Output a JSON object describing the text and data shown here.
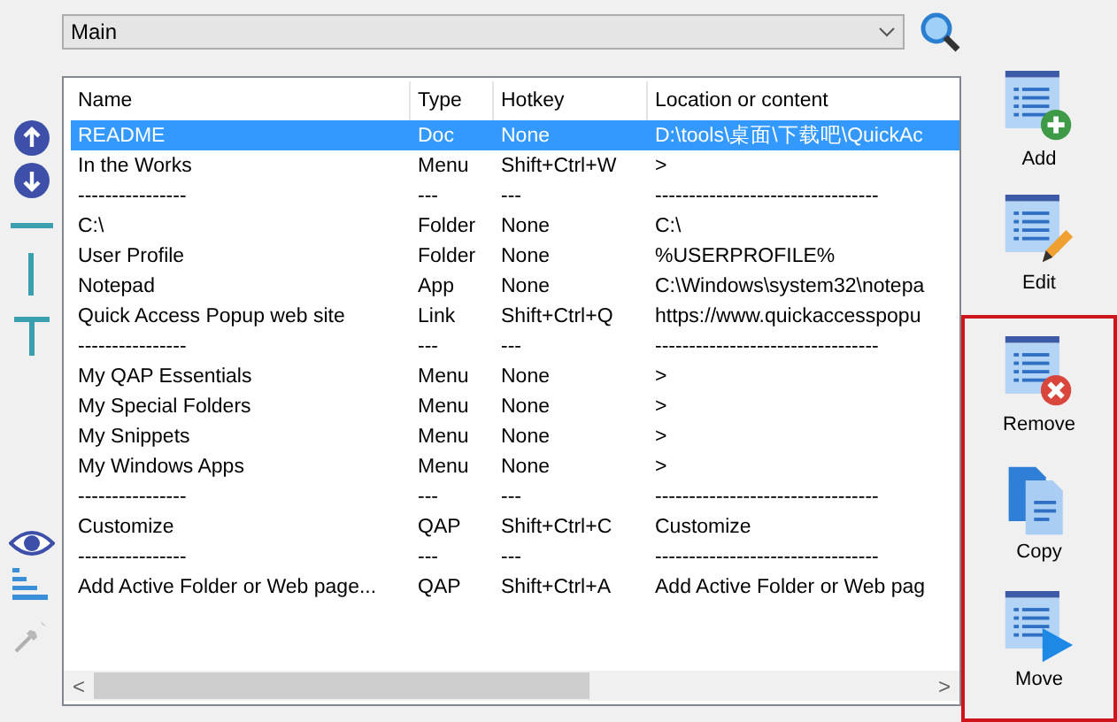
{
  "menu_dropdown": {
    "value": "Main"
  },
  "table": {
    "columns": [
      "Name",
      "Type",
      "Hotkey",
      "Location or content"
    ],
    "rows": [
      {
        "cells": [
          "README",
          "Doc",
          "None",
          "D:\\tools\\桌面\\下载吧\\QuickAc"
        ],
        "selected": true
      },
      {
        "cells": [
          "In the Works",
          "Menu",
          "Shift+Ctrl+W",
          ">"
        ],
        "selected": false
      },
      {
        "cells": [
          "----------------",
          "---",
          "---",
          "---------------------------------"
        ],
        "selected": false
      },
      {
        "cells": [
          "C:\\",
          "Folder",
          "None",
          "C:\\"
        ],
        "selected": false
      },
      {
        "cells": [
          "User Profile",
          "Folder",
          "None",
          "%USERPROFILE%"
        ],
        "selected": false
      },
      {
        "cells": [
          "Notepad",
          "App",
          "None",
          "C:\\Windows\\system32\\notepa"
        ],
        "selected": false
      },
      {
        "cells": [
          "Quick Access Popup web site",
          "Link",
          "Shift+Ctrl+Q",
          "https://www.quickaccesspopu"
        ],
        "selected": false
      },
      {
        "cells": [
          "----------------",
          "---",
          "---",
          "---------------------------------"
        ],
        "selected": false
      },
      {
        "cells": [
          "My QAP Essentials",
          "Menu",
          "None",
          ">"
        ],
        "selected": false
      },
      {
        "cells": [
          "My Special Folders",
          "Menu",
          "None",
          ">"
        ],
        "selected": false
      },
      {
        "cells": [
          "My Snippets",
          "Menu",
          "None",
          ">"
        ],
        "selected": false
      },
      {
        "cells": [
          "My Windows Apps",
          "Menu",
          "None",
          ">"
        ],
        "selected": false
      },
      {
        "cells": [
          "----------------",
          "---",
          "---",
          "---------------------------------"
        ],
        "selected": false
      },
      {
        "cells": [
          "Customize",
          "QAP",
          "Shift+Ctrl+C",
          "Customize"
        ],
        "selected": false
      },
      {
        "cells": [
          "----------------",
          "---",
          "---",
          "---------------------------------"
        ],
        "selected": false
      },
      {
        "cells": [
          "Add Active Folder or Web page...",
          "QAP",
          "Shift+Ctrl+A",
          "Add Active Folder or Web pag"
        ],
        "selected": false
      }
    ],
    "scroll_arrows": [
      "<",
      ">"
    ]
  },
  "actions": [
    {
      "label": "Add",
      "kind": "add",
      "highlighted": false
    },
    {
      "label": "Edit",
      "kind": "edit",
      "highlighted": false
    },
    {
      "label": "Remove",
      "kind": "remove",
      "highlighted": true
    },
    {
      "label": "Copy",
      "kind": "copy",
      "highlighted": true
    },
    {
      "label": "Move",
      "kind": "move",
      "highlighted": true
    }
  ]
}
